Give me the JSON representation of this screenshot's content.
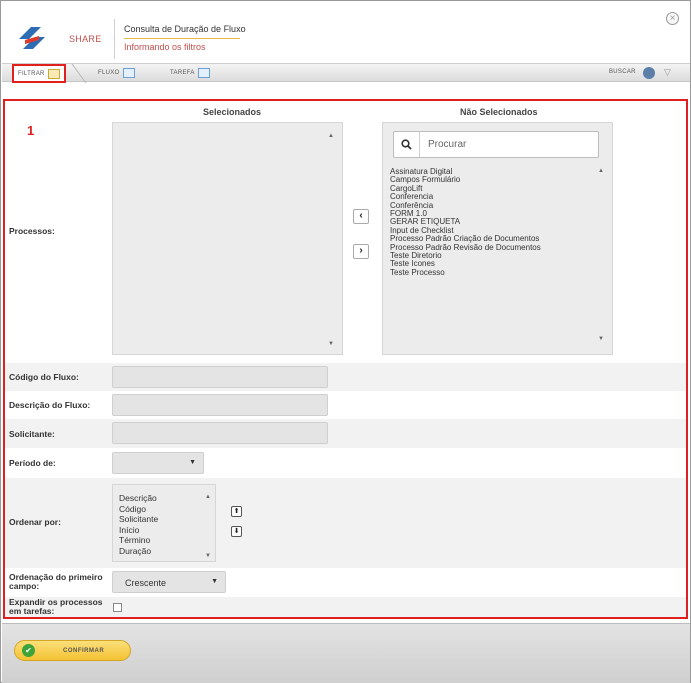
{
  "header": {
    "brand": "SHARE",
    "title": "Consulta de Duração de Fluxo",
    "subtitle": "Informando os filtros"
  },
  "tabs": [
    {
      "label": "FILTRAR",
      "icon": "funnel-icon"
    },
    {
      "label": "FLUXO",
      "icon": "grid-icon"
    },
    {
      "label": "TAREFA",
      "icon": "grid-icon"
    }
  ],
  "toolbar": {
    "search_label": "BUSCAR"
  },
  "annotation": {
    "number": "1"
  },
  "processos": {
    "label": "Processos:",
    "selected_header": "Selecionados",
    "unselected_header": "Não Selecionados",
    "search_placeholder": "Procurar",
    "available": [
      "Assinatura Digital",
      "Campos Formulário",
      "CargoLift",
      "Conferencia",
      "Conferência",
      "FORM 1.0",
      "GERAR ETIQUETA",
      "Input de Checklist",
      "Processo Padrão Criação de Documentos",
      "Processo Padrão Revisão de Documentos",
      "Teste Diretorio",
      "Teste Icones",
      "Teste Processo"
    ]
  },
  "fields": {
    "codigo_label": "Código do Fluxo:",
    "descricao_label": "Descrição do Fluxo:",
    "solicitante_label": "Solicitante:",
    "periodo_label": "Período de:",
    "periodo_value": "",
    "ordenar_label": "Ordenar por:",
    "ordenar_options": [
      "Descrição",
      "Código",
      "Solicitante",
      "Início",
      "Término",
      "Duração"
    ],
    "ordenacao_label_1": "Ordenação do primeiro",
    "ordenacao_label_2": "campo:",
    "ordenacao_value": "Crescente",
    "expandir_label_1": "Expandir os processos",
    "expandir_label_2": "em tarefas:",
    "expandir_checked": false
  },
  "footer": {
    "confirm_label": "CONFIRMAR"
  },
  "colors": {
    "highlight": "#e02020",
    "accent": "#f4c233",
    "brand": "#c0504d"
  }
}
